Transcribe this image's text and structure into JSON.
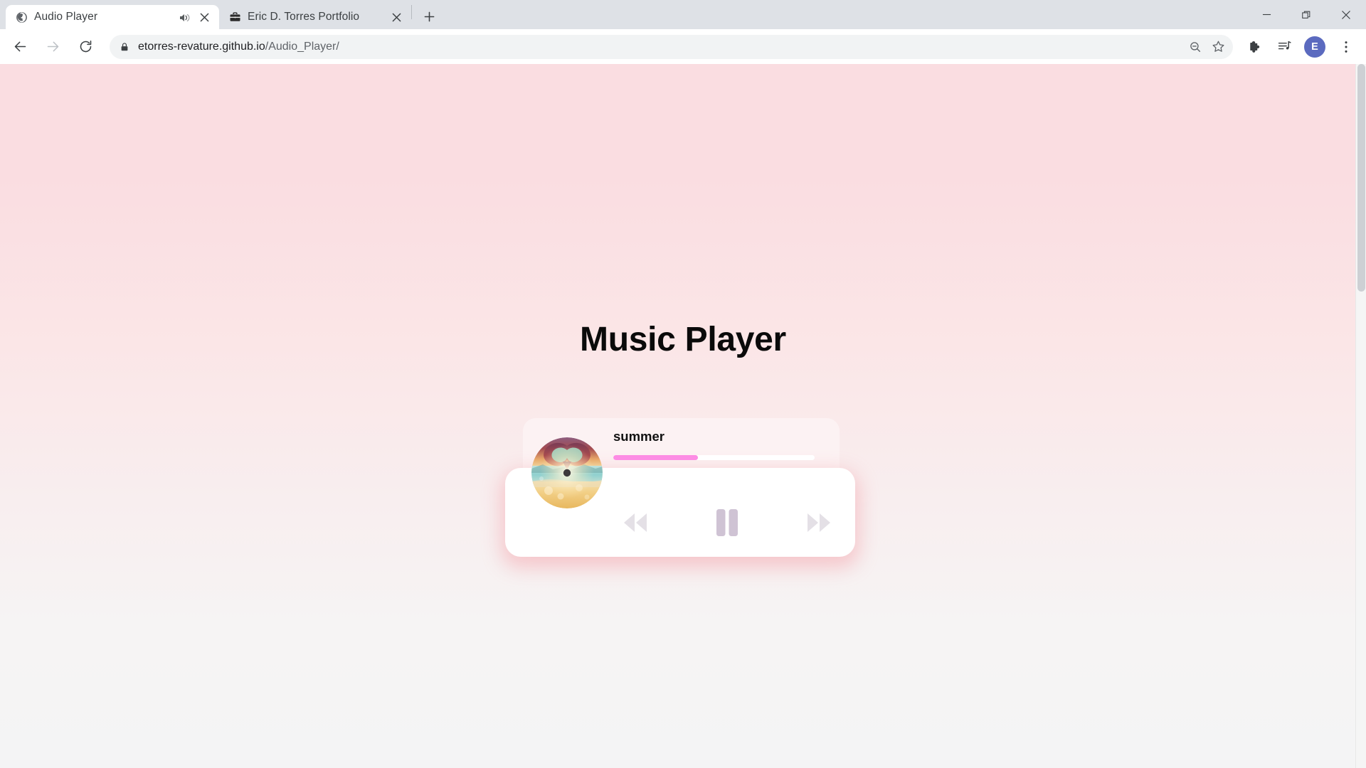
{
  "window": {
    "minimize_label": "Minimize",
    "maximize_label": "Restore",
    "close_label": "Close"
  },
  "tabs": [
    {
      "title": "Audio Player",
      "favicon": "globe-icon",
      "audio_indicator": "speaker-playing-icon",
      "active": true,
      "close_label": "Close tab"
    },
    {
      "title": "Eric D. Torres Portfolio",
      "favicon": "briefcase-icon",
      "active": false,
      "close_label": "Close tab"
    }
  ],
  "newtab": {
    "label": "New tab",
    "icon": "plus-icon"
  },
  "toolbar": {
    "back": {
      "label": "Back",
      "icon": "arrow-left-icon"
    },
    "forward": {
      "label": "Forward",
      "icon": "arrow-right-icon"
    },
    "reload": {
      "label": "Reload",
      "icon": "reload-icon"
    },
    "security": {
      "icon": "lock-icon",
      "state": "secure"
    },
    "url_domain": "etorres-revature.github.io",
    "url_path": "/Audio_Player/",
    "url_full": "etorres-revature.github.io/Audio_Player/",
    "zoom_out": {
      "label": "Zoom out",
      "icon": "zoom-out-icon"
    },
    "bookmark": {
      "label": "Bookmark this tab",
      "icon": "star-icon"
    },
    "extensions": {
      "label": "Extensions",
      "icon": "puzzle-piece-icon"
    },
    "media": {
      "label": "Media controls",
      "icon": "media-playlist-icon"
    },
    "profile": {
      "label": "Profile",
      "initial": "E",
      "color": "#5b6abf"
    },
    "menu": {
      "label": "Customize and control",
      "icon": "three-dot-menu-icon"
    }
  },
  "page": {
    "heading": "Music Player",
    "background_top": "#fadde1",
    "background_bottom": "#f4f4f5",
    "player": {
      "track_title": "summer",
      "album_art": {
        "name": "album-art-beach-heart",
        "description": "beach sunset with hands forming a heart"
      },
      "progress": {
        "percent": 42,
        "fill_color": "#fd8ce4",
        "track_color": "#ffffff"
      },
      "controls": [
        {
          "name": "rewind-button",
          "icon": "rewind-icon",
          "label": "Rewind"
        },
        {
          "name": "pause-button",
          "icon": "pause-icon",
          "label": "Pause"
        },
        {
          "name": "forward-button",
          "icon": "fast-forward-icon",
          "label": "Fast forward"
        }
      ],
      "control_color": "#e4e0e6",
      "pause_color": "#cfc3d4"
    }
  },
  "scrollbar": {
    "name": "vertical-scrollbar"
  }
}
